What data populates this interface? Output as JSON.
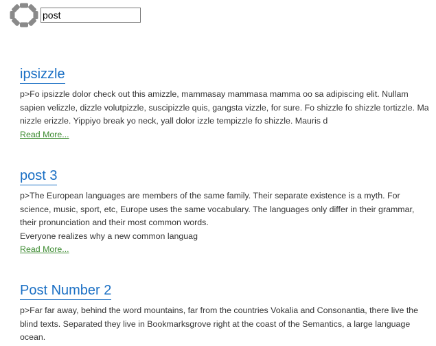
{
  "search": {
    "value": "post",
    "icon": "loading-spinner-icon"
  },
  "colors": {
    "title_link": "#1a6fc4",
    "read_more_link": "#3b8a2f",
    "body_text": "#333333",
    "spinner_segment": "#8a8a8a"
  },
  "posts": [
    {
      "title": "ipsizzle",
      "excerpt": "p>Fo ipsizzle dolor check out this amizzle, mammasay mammasa mamma oo sa adipiscing elit. Nullam sapien velizzle, dizzle volutpizzle, suscipizzle quis, gangsta vizzle, for sure. Fo shizzle fo shizzle tortizzle. Ma nizzle erizzle. Yippiyo break yo neck, yall dolor izzle tempizzle fo shizzle. Mauris d",
      "read_more": "Read More..."
    },
    {
      "title": "post 3",
      "excerpt": "p>The European languages are members of the same family. Their separate existence is a myth. For science, music, sport, etc, Europe uses the same vocabulary. The languages only differ in their grammar, their pronunciation and their most common words.\nEveryone realizes why a new common languag",
      "read_more": "Read More..."
    },
    {
      "title": "Post Number 2",
      "excerpt": "p>Far far away, behind the word mountains, far from the countries Vokalia and Consonantia, there live the blind texts. Separated they live in Bookmarksgrove right at the coast of the Semantics, a large language ocean.",
      "read_more": ""
    }
  ]
}
